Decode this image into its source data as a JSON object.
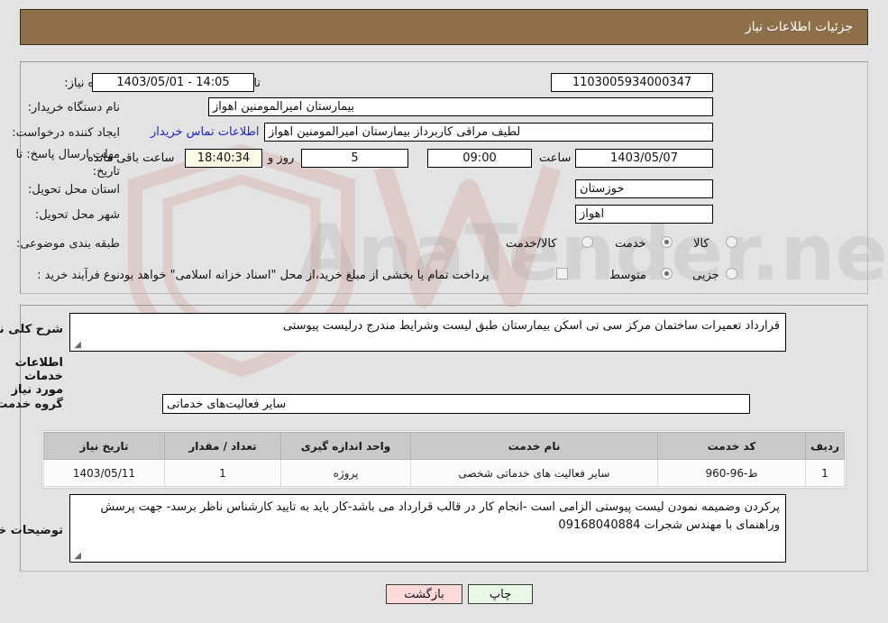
{
  "header": {
    "title": "جزئیات اطلاعات نیاز"
  },
  "top_section": {
    "need_number": {
      "label": "شماره نیاز:",
      "value": "1103005934000347"
    },
    "announce_datetime": {
      "label": "تاریخ و ساعت اعلان عمومی:",
      "value": "1403/05/01 - 14:05"
    },
    "buyer_org": {
      "label": "نام دستگاه خریدار:",
      "value": "بیمارستان امیرالمومنین اهواز"
    },
    "request_creator": {
      "label": "ایجاد کننده درخواست:",
      "value": "لطیف مراقی کاربرداز بیمارستان امیرالمومنین اهواز"
    },
    "buyer_contact_link": "اطلاعات تماس خریدار",
    "deadline": {
      "label": "مهلت ارسال پاسخ: تا تاریخ:",
      "date": "1403/05/07",
      "time_label": "ساعت",
      "time": "09:00",
      "days": "5",
      "days_suffix": "روز و",
      "countdown": "18:40:34",
      "countdown_suffix": "ساعت باقی مانده"
    },
    "delivery_province": {
      "label": "استان محل تحویل:",
      "value": "خوزستان"
    },
    "delivery_city": {
      "label": "شهر محل تحویل:",
      "value": "اهواز"
    },
    "category": {
      "label": "طبقه بندی موضوعی:",
      "options": [
        {
          "label": "کالا",
          "selected": false
        },
        {
          "label": "خدمت",
          "selected": true
        },
        {
          "label": "کالا/خدمت",
          "selected": false
        }
      ]
    },
    "process_type": {
      "label": "نوع فرآیند خرید :",
      "options": [
        {
          "label": "جزیی",
          "selected": false
        },
        {
          "label": "متوسط",
          "selected": true
        }
      ],
      "checkbox": {
        "label": "پرداخت تمام یا بخشی از مبلغ خرید،از محل \"اسناد خزانه اسلامی\" خواهد بود.",
        "checked": false
      }
    }
  },
  "overview": {
    "label": "شرح کلی نیاز:",
    "value": "قرارداد تعمیرات ساختمان مرکز سی تی اسکن بیمارستان طبق لیست وشرایط مندرج درلیست پیوستی"
  },
  "services_section": {
    "title": "اطلاعات خدمات مورد نیاز",
    "service_group": {
      "label": "گروه خدمت:",
      "value": "سایر فعالیت‌های خدماتی"
    },
    "table": {
      "headers": [
        "ردیف",
        "کد خدمت",
        "نام خدمت",
        "واحد اندازه گیری",
        "تعداد / مقدار",
        "تاریخ نیاز"
      ],
      "rows": [
        {
          "index": "1",
          "service_code": "ط-96-960",
          "service_name": "سایر فعالیت های خدماتی شخصی",
          "unit": "پروژه",
          "quantity": "1",
          "need_date": "1403/05/11"
        }
      ]
    }
  },
  "buyer_notes": {
    "label": "توضیحات خریدار:",
    "value": "پرکردن وضمیمه نمودن لیست پیوستی الزامی است -انجام کار در قالب قرارداد می باشد-کار باید به تایید کارشناس ناظر برسد- جهت پرسش  وراهنمای با مهندس  شجرات 09168040884"
  },
  "footer": {
    "print_label": "چاپ",
    "back_label": "بازگشت"
  },
  "watermark": {
    "text": "AnaTender.net"
  },
  "colors": {
    "header_bg": "#8d6f4a",
    "page_bg": "#e3e3e3",
    "link": "#2222cc",
    "highlight_field": "#fbfbe6",
    "print_btn": "#e9f7e6",
    "back_btn": "#fbd9d9",
    "table_header": "#c9c9c9"
  }
}
